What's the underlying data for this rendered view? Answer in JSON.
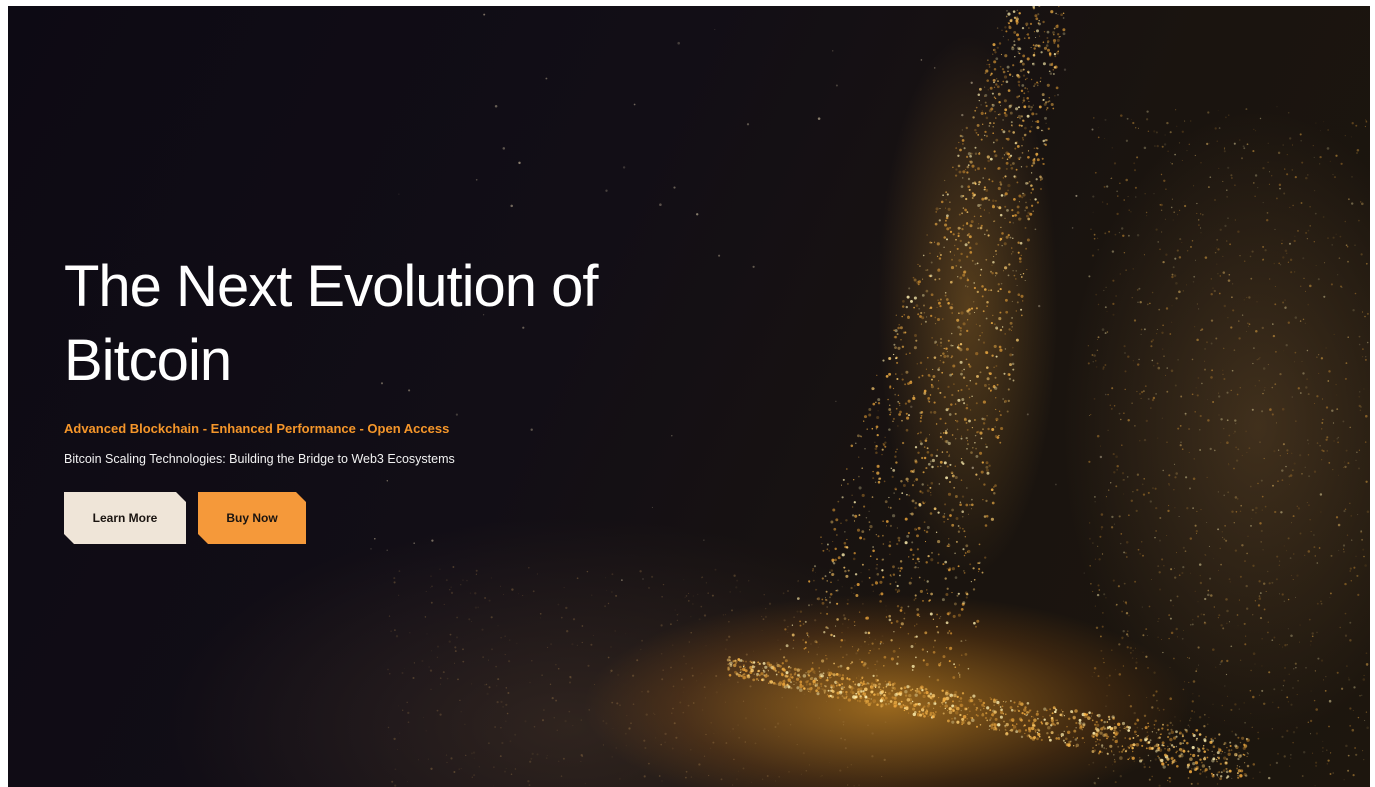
{
  "hero": {
    "headline_line1": "The Next Evolution of",
    "headline_line2": "Bitcoin",
    "tagline": "Advanced Blockchain - Enhanced Performance - Open Access",
    "subtitle": "Bitcoin Scaling Technologies: Building the Bridge to Web3 Ecosystems",
    "background_icon": "golden-particle-stream"
  },
  "actions": {
    "learn_more_label": "Learn More",
    "buy_now_label": "Buy Now"
  },
  "colors": {
    "background": "#0f0b12",
    "accent": "#f5993a",
    "tagline": "#f5962a",
    "secondary_button": "#efe5d8",
    "text": "#ffffff"
  }
}
